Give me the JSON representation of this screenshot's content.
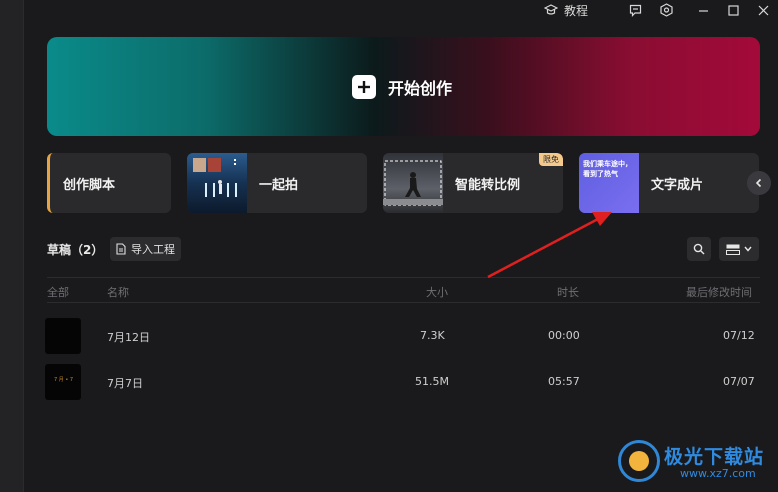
{
  "titlebar": {
    "tutorial_label": "教程",
    "icons": [
      "graduation-cap-icon",
      "feedback-icon",
      "settings-hex-icon",
      "minimize-icon",
      "maximize-icon",
      "close-icon"
    ]
  },
  "hero": {
    "label": "开始创作",
    "icon": "plus-icon"
  },
  "feature_cards": [
    {
      "label": "创作脚本"
    },
    {
      "label": "一起拍"
    },
    {
      "label": "智能转比例",
      "badge": "限免"
    },
    {
      "label": "文字成片",
      "thumb_text": "我们乘车途中，看到了热气"
    }
  ],
  "drafts": {
    "title": "草稿（2）",
    "import_label": "导入工程",
    "columns": [
      "全部",
      "名称",
      "大小",
      "时长",
      "最后修改时间"
    ],
    "rows": [
      {
        "name": "7月12日",
        "size": "7.3K",
        "duration": "00:00",
        "modified": "07/12",
        "thumb_text": ""
      },
      {
        "name": "7月7日",
        "size": "51.5M",
        "duration": "05:57",
        "modified": "07/07",
        "thumb_text": "7 月 • 7"
      }
    ]
  },
  "watermark": {
    "name": "极光下载站",
    "url": "www.xz7.com"
  },
  "colors": {
    "accent_orange": "#e6a447",
    "annotation_red": "#e02020",
    "hero_teal": "#0a8b8a",
    "hero_crimson": "#a30a3a"
  }
}
